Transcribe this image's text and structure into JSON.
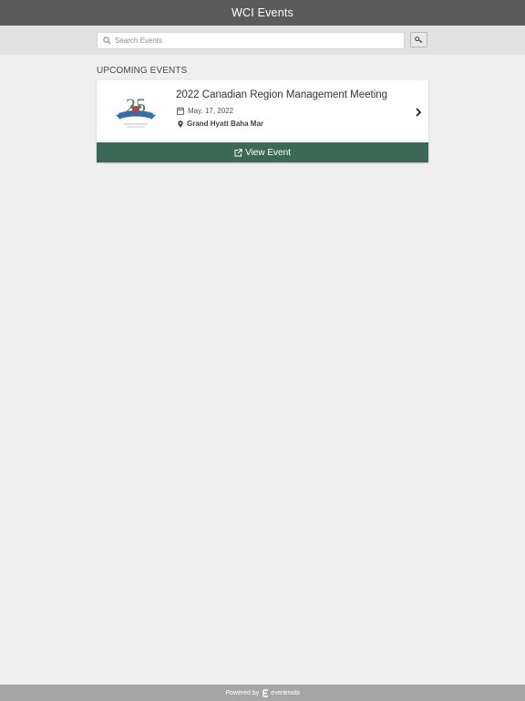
{
  "header": {
    "title": "WCI Events"
  },
  "search": {
    "placeholder": "Search Events",
    "value": ""
  },
  "section": {
    "heading": "UPCOMING EVENTS"
  },
  "events": [
    {
      "title": "2022 Canadian Region Management Meeting",
      "date": "May. 17, 2022",
      "venue": "Grand Hyatt Baha Mar",
      "logo_text": "25",
      "action_label": "View Event"
    }
  ],
  "footer": {
    "powered_by": "Powered by",
    "brand": "eventmobi"
  },
  "colors": {
    "header_bg": "#5b5b5b",
    "accent_green": "#3c6956",
    "page_bg": "#efefef",
    "footer_bg": "#a6a6a6"
  },
  "icons": {
    "search": "search-icon",
    "key": "key-icon",
    "calendar": "calendar-icon",
    "location": "map-marker-icon",
    "chevron": "chevron-right-icon",
    "external": "external-link-icon"
  }
}
